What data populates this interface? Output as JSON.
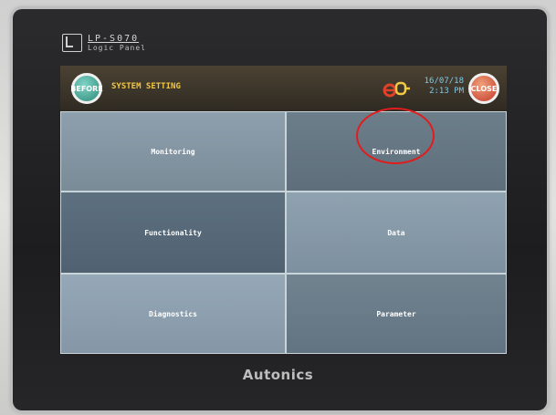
{
  "device": {
    "model_title": "LP-S070",
    "model_subtitle": "Logic Panel",
    "brand": "Autonics"
  },
  "header": {
    "before_label": "BEFORE",
    "title": "SYSTEM SETTING",
    "date": "16/07/18",
    "time": "2:13 PM",
    "close_label": "CLOSE"
  },
  "menu": {
    "items": [
      {
        "label": "Monitoring"
      },
      {
        "label": "Environment"
      },
      {
        "label": "Functionality"
      },
      {
        "label": "Data"
      },
      {
        "label": "Diagnostics"
      },
      {
        "label": "Parameter"
      }
    ]
  },
  "annotation": {
    "highlighted_item": "Environment",
    "color": "#e21c1c"
  },
  "colors": {
    "title_text": "#f2c842",
    "datetime_text": "#7ec9e6",
    "before_button": "#2f8c7a",
    "close_button": "#c33a2a"
  }
}
